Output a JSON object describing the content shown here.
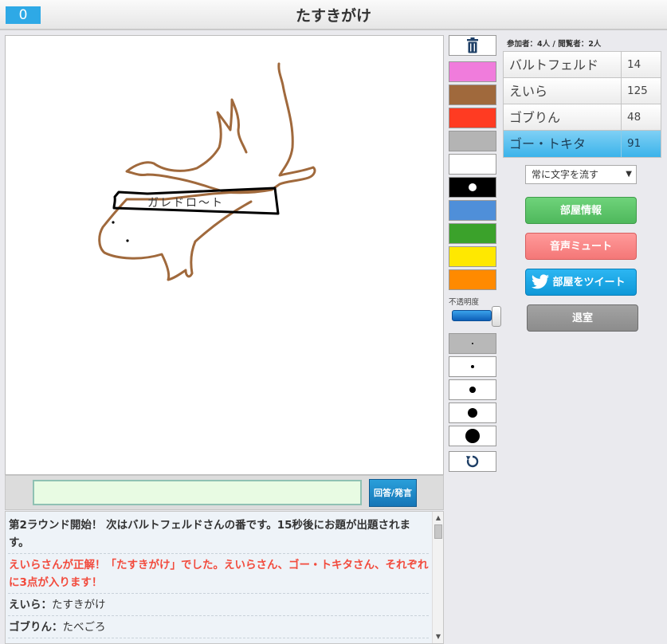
{
  "header": {
    "score": "0",
    "title": "たすきがけ"
  },
  "canvas": {
    "drawing_text": "ガレドロ〜ト"
  },
  "answer": {
    "input_value": "",
    "submit_label": "回答/発言"
  },
  "chat": [
    {
      "type": "system",
      "text": "第2ラウンド開始！ 次はバルトフェルドさんの番です。15秒後にお題が出題されます。"
    },
    {
      "type": "correct",
      "text": "えいらさんが正解！「たすきがけ」でした。えいらさん、ゴー・トキタさん、それぞれに3点が入ります！"
    },
    {
      "type": "user",
      "user": "えいら",
      "text": "たすきがけ"
    },
    {
      "type": "user",
      "user": "ゴブりん",
      "text": "たべごろ"
    }
  ],
  "tools": {
    "opacity_label": "不透明度",
    "opacity_value": 1.0,
    "colors": [
      "#f07cdc",
      "#a0693c",
      "#ff3b22",
      "#b4b4b4",
      "#ffffff",
      "#000000",
      "#4f8fd9",
      "#3ba22b",
      "#ffe800",
      "#ff8a00"
    ],
    "selected_color_index": 5,
    "pen_sizes": [
      2,
      4,
      8,
      12,
      18
    ],
    "selected_pen_index": 0,
    "icons": [
      "trash-icon",
      "undo-icon"
    ]
  },
  "sidebar": {
    "participants_label": "参加者：4人 / 閲覧者：2人",
    "players": [
      {
        "name": "バルトフェルド",
        "score": "14"
      },
      {
        "name": "えいら",
        "score": "125"
      },
      {
        "name": "ゴブりん",
        "score": "48"
      },
      {
        "name": "ゴー・トキタ",
        "score": "91"
      }
    ],
    "current_player_index": 3,
    "text_scroll_option": "常に文字を流す",
    "room_info_label": "部屋情報",
    "mute_label": "音声ミュート",
    "tweet_label": "部屋をツイート",
    "exit_label": "退室"
  },
  "colors": {
    "accent": "#2ea9e6",
    "room_button": "#5cc468",
    "mute_button": "#f88686",
    "tweet_button": "#17a8e6",
    "exit_button": "#969696",
    "correct_text": "#f24a3c"
  }
}
